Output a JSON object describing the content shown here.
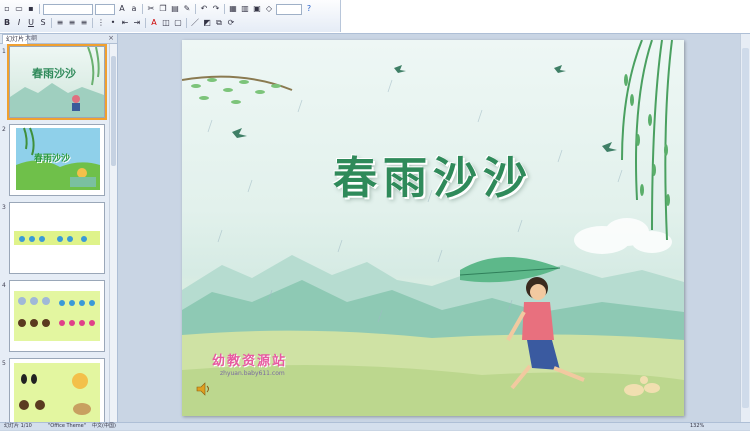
{
  "toolbar": {
    "font_name": "",
    "font_size": "",
    "zoom_combo": ""
  },
  "pane": {
    "tab_slides": "幻灯片",
    "tab_outline": "大纲",
    "close": "×",
    "thumb_numbers": [
      "1",
      "2",
      "3",
      "4",
      "5"
    ],
    "thumb1_title": "春雨沙沙",
    "thumb2_title": "春雨沙沙"
  },
  "slide": {
    "title": "春雨沙沙",
    "logo_text": "幼教资源站",
    "logo_url": "zhyuan.baby611.com"
  },
  "status": {
    "slide_info": "幻灯片 1/10",
    "theme": "\"Office Theme\"",
    "language": "中文(中国)",
    "zoom": "132%"
  },
  "colors": {
    "title": "#2f8a5a",
    "logo": "#e75aa0",
    "selection": "#f0a030"
  }
}
